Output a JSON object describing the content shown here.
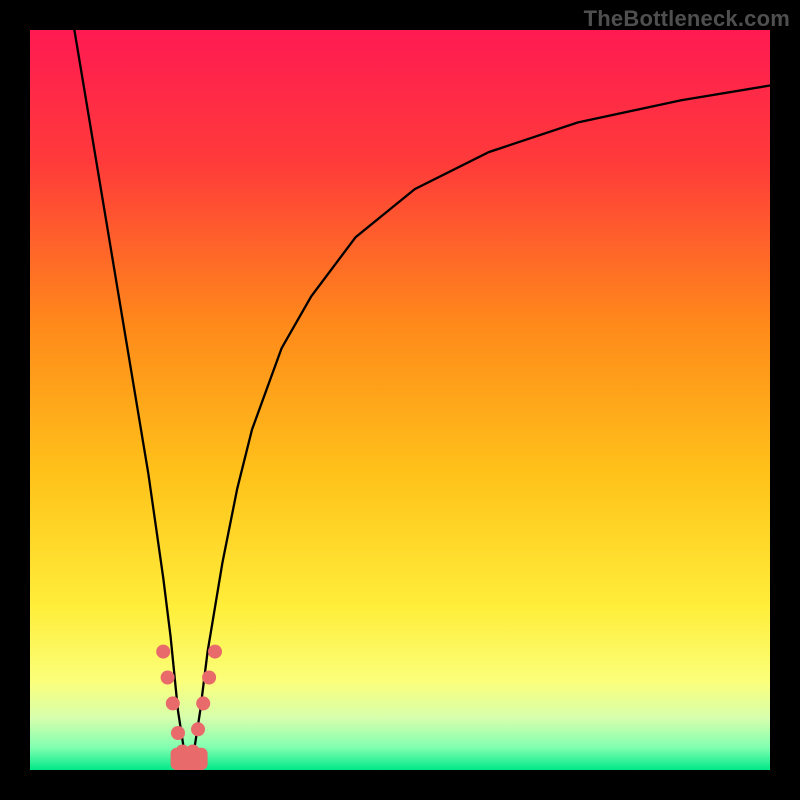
{
  "watermark": "TheBottleneck.com",
  "chart_data": {
    "type": "line",
    "title": "",
    "xlabel": "",
    "ylabel": "",
    "xlim": [
      0,
      100
    ],
    "ylim": [
      0,
      100
    ],
    "grid": false,
    "legend": false,
    "background_gradient": {
      "stops": [
        {
          "pos": 0.0,
          "color": "#ff1a52"
        },
        {
          "pos": 0.18,
          "color": "#ff3b3a"
        },
        {
          "pos": 0.4,
          "color": "#ff8a1a"
        },
        {
          "pos": 0.6,
          "color": "#ffc21a"
        },
        {
          "pos": 0.78,
          "color": "#ffee3a"
        },
        {
          "pos": 0.88,
          "color": "#fbff7a"
        },
        {
          "pos": 0.93,
          "color": "#d6ffad"
        },
        {
          "pos": 0.97,
          "color": "#7fffb0"
        },
        {
          "pos": 1.0,
          "color": "#00e888"
        }
      ]
    },
    "series": [
      {
        "name": "bottleneck-curve",
        "color": "#000000",
        "width": 2.3,
        "x": [
          6.0,
          8.0,
          10.0,
          12.0,
          14.0,
          16.0,
          18.0,
          19.0,
          20.0,
          21.0,
          22.0,
          23.0,
          24.0,
          26.0,
          28.0,
          30.0,
          34.0,
          38.0,
          44.0,
          52.0,
          62.0,
          74.0,
          88.0,
          100.0
        ],
        "y": [
          100.0,
          88.0,
          76.0,
          64.0,
          52.0,
          40.0,
          26.0,
          18.0,
          8.0,
          1.5,
          1.5,
          8.0,
          16.0,
          28.0,
          38.0,
          46.0,
          57.0,
          64.0,
          72.0,
          78.5,
          83.5,
          87.5,
          90.5,
          92.5
        ]
      },
      {
        "name": "highlight-dots",
        "color": "#e86a6a",
        "type": "scatter",
        "marker_radius": 7,
        "x": [
          18.0,
          18.6,
          19.3,
          20.0,
          20.6,
          21.4,
          22.0,
          22.7,
          23.4,
          24.2,
          25.0
        ],
        "y": [
          16.0,
          12.5,
          9.0,
          5.0,
          2.5,
          1.5,
          2.5,
          5.5,
          9.0,
          12.5,
          16.0
        ]
      }
    ],
    "notch": {
      "x_range": [
        19.0,
        24.0
      ],
      "color": "#e86a6a"
    }
  }
}
